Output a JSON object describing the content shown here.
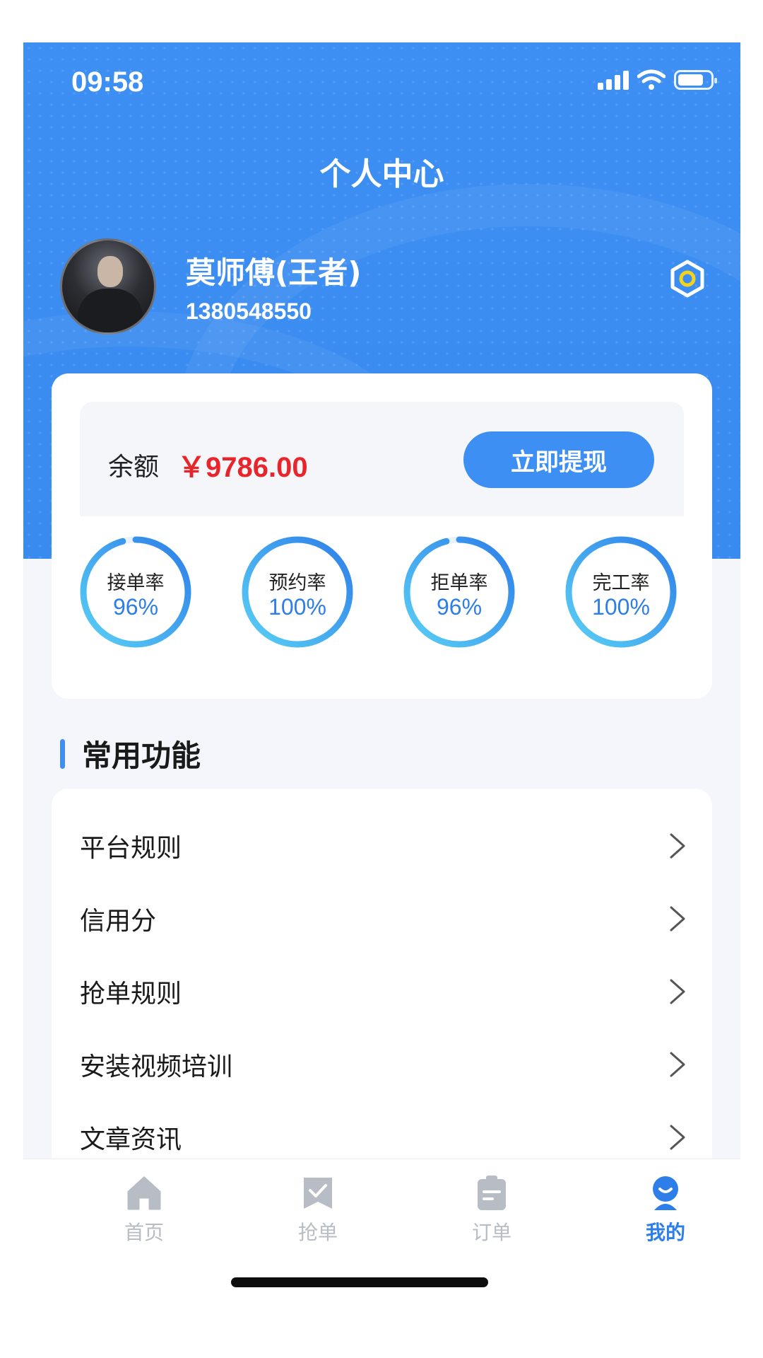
{
  "status_bar": {
    "time": "09:58"
  },
  "page_title": "个人中心",
  "user": {
    "name": "莫师傅(王者)",
    "phone": "1380548550"
  },
  "balance": {
    "label": "余额",
    "value": "￥9786.00",
    "button": "立即提现"
  },
  "stats": [
    {
      "label": "接单率",
      "value": "96%",
      "fraction": 0.96
    },
    {
      "label": "预约率",
      "value": "100%",
      "fraction": 1.0
    },
    {
      "label": "拒单率",
      "value": "96%",
      "fraction": 0.96
    },
    {
      "label": "完工率",
      "value": "100%",
      "fraction": 1.0
    }
  ],
  "section": {
    "title": "常用功能"
  },
  "menu": [
    {
      "label": "平台规则"
    },
    {
      "label": "信用分"
    },
    {
      "label": "抢单规则"
    },
    {
      "label": "安装视频培训"
    },
    {
      "label": "文章资讯"
    }
  ],
  "tabbar": [
    {
      "label": "首页",
      "icon": "home-icon",
      "active": false
    },
    {
      "label": "抢单",
      "icon": "grab-order-icon",
      "active": false
    },
    {
      "label": "订单",
      "icon": "order-icon",
      "active": false
    },
    {
      "label": "我的",
      "icon": "profile-icon",
      "active": true
    }
  ],
  "colors": {
    "primary": "#3d8ff3",
    "balance": "#e8252b",
    "ring_gradient": [
      "#5ad0f5",
      "#2d7ee8"
    ],
    "tab_inactive": "#b8bcc4",
    "tab_active": "#2d7ee8"
  }
}
